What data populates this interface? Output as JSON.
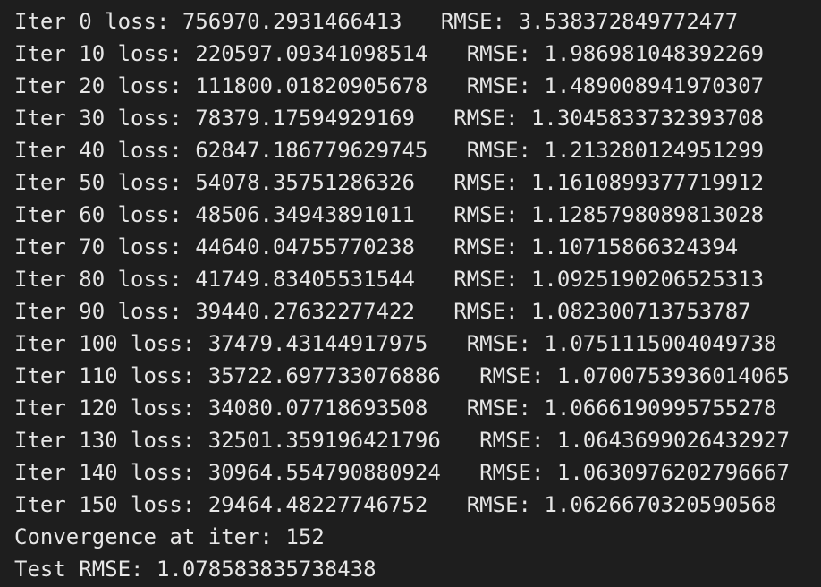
{
  "terminal": {
    "lines": [
      "Iter 0 loss: 756970.2931466413   RMSE: 3.538372849772477",
      "Iter 10 loss: 220597.09341098514   RMSE: 1.986981048392269",
      "Iter 20 loss: 111800.01820905678   RMSE: 1.489008941970307",
      "Iter 30 loss: 78379.17594929169   RMSE: 1.3045833732393708",
      "Iter 40 loss: 62847.186779629745   RMSE: 1.213280124951299",
      "Iter 50 loss: 54078.35751286326   RMSE: 1.1610899377719912",
      "Iter 60 loss: 48506.34943891011   RMSE: 1.1285798089813028",
      "Iter 70 loss: 44640.04755770238   RMSE: 1.10715866324394",
      "Iter 80 loss: 41749.83405531544   RMSE: 1.0925190206525313",
      "Iter 90 loss: 39440.27632277422   RMSE: 1.082300713753787",
      "Iter 100 loss: 37479.43144917975   RMSE: 1.0751115004049738",
      "Iter 110 loss: 35722.697733076886   RMSE: 1.0700753936014065",
      "Iter 120 loss: 34080.07718693508   RMSE: 1.0666190995755278",
      "Iter 130 loss: 32501.359196421796   RMSE: 1.0643699026432927",
      "Iter 140 loss: 30964.554790880924   RMSE: 1.0630976202796667",
      "Iter 150 loss: 29464.48227746752   RMSE: 1.0626670320590568",
      "Convergence at iter: 152",
      "Test RMSE: 1.078583835738438"
    ]
  },
  "colors": {
    "background": "#1e1e1e",
    "text": "#e6e6e6"
  }
}
